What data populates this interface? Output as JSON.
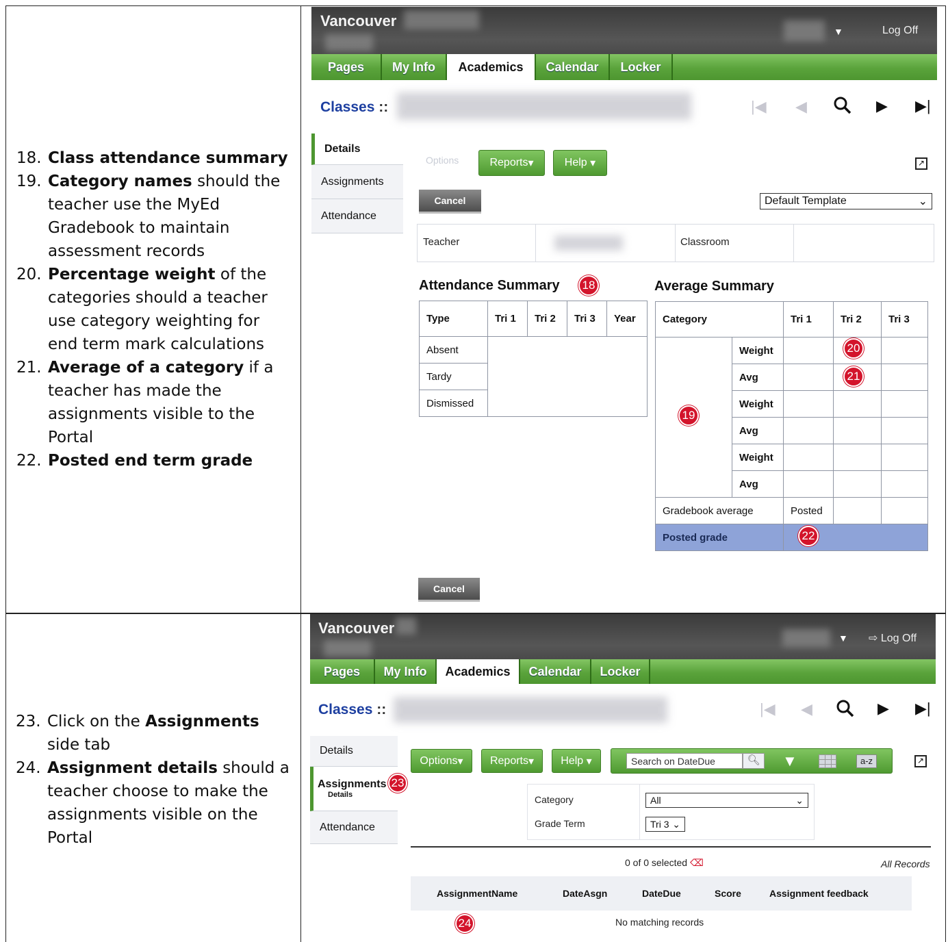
{
  "instructions_top": [
    {
      "num": "18.",
      "bold": "Class attendance summary",
      "rest": ""
    },
    {
      "num": "19.",
      "bold": "Category names",
      "rest": " should the teacher use the MyEd Gradebook to maintain assessment records"
    },
    {
      "num": "20.",
      "bold": "Percentage weight",
      "rest": " of the categories should a teacher use category weighting for end term mark calculations"
    },
    {
      "num": "21.",
      "bold": "Average of a category",
      "rest": " if a teacher has made the assignments visible to the Portal"
    },
    {
      "num": "22.",
      "bold": "Posted end term grade",
      "rest": ""
    }
  ],
  "instructions_bottom": [
    {
      "num": "23.",
      "pre": "Click on the ",
      "bold": "Assignments",
      "rest": " side tab"
    },
    {
      "num": "24.",
      "pre": "",
      "bold": "Assignment details",
      "rest": " should a teacher choose to make the assignments visible on the Portal"
    }
  ],
  "app": {
    "brand": "Vancouver",
    "logoff": "Log Off",
    "tabs": [
      "Pages",
      "My Info",
      "Academics",
      "Calendar",
      "Locker"
    ],
    "active_tab": "Academics",
    "classes_label": "Classes",
    "classes_sep": "::"
  },
  "screen1": {
    "side_tabs": [
      "Details",
      "Assignments",
      "Attendance"
    ],
    "options_label": "Options",
    "reports_label": "Reports",
    "help_label": "Help",
    "cancel_label": "Cancel",
    "template_value": "Default Template",
    "teacher_label": "Teacher",
    "classroom_label": "Classroom",
    "attendance_title": "Attendance Summary",
    "attendance_cols": [
      "Type",
      "Tri 1",
      "Tri 2",
      "Tri 3",
      "Year"
    ],
    "attendance_rows": [
      "Absent",
      "Tardy",
      "Dismissed"
    ],
    "average_title": "Average Summary",
    "average_cols": [
      "Category",
      "Tri 1",
      "Tri 2",
      "Tri 3"
    ],
    "average_rows": [
      "Weight",
      "Avg",
      "Weight",
      "Avg",
      "Weight",
      "Avg"
    ],
    "gradebook_avg_label": "Gradebook average",
    "posted_label": "Posted",
    "posted_grade_label": "Posted grade",
    "badges": [
      "18",
      "19",
      "20",
      "21",
      "22"
    ]
  },
  "screen2": {
    "side_tabs": [
      "Details",
      "Assignments",
      "Attendance"
    ],
    "assignments_sub": "Details",
    "options_label": "Options",
    "reports_label": "Reports",
    "help_label": "Help",
    "search_placeholder": "Search on DateDue",
    "az_label": "a-z",
    "category_label": "Category",
    "category_value": "All",
    "grade_term_label": "Grade Term",
    "grade_term_value": "Tri 3",
    "selected_text": "0 of 0 selected",
    "all_records": "All Records",
    "columns": [
      "AssignmentName",
      "DateAsgn",
      "DateDue",
      "Score",
      "Assignment feedback"
    ],
    "no_records": "No matching records",
    "badges": [
      "23",
      "24"
    ]
  }
}
